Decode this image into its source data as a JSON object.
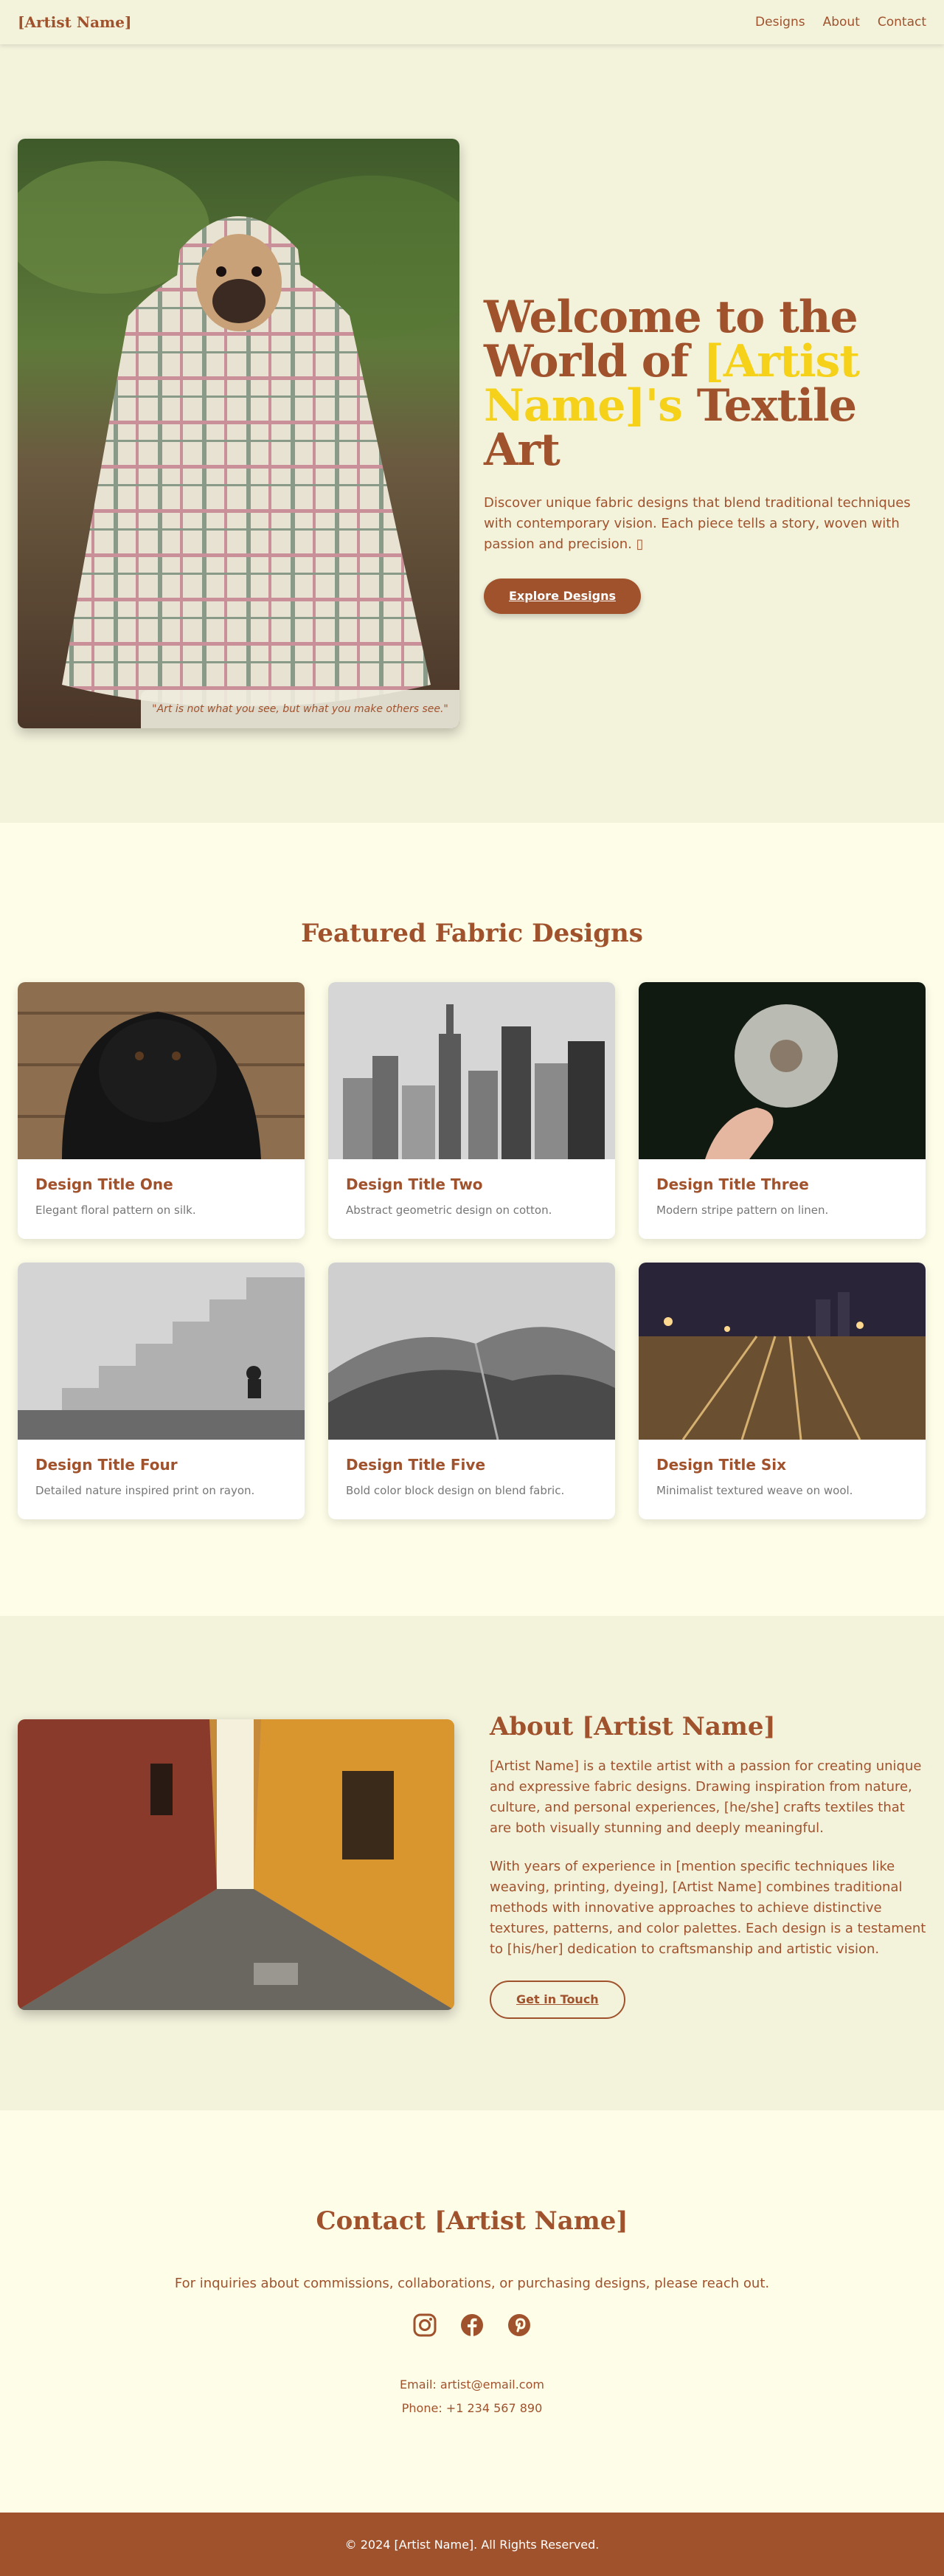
{
  "nav": {
    "brand": "[Artist Name]",
    "links": [
      "Designs",
      "About",
      "Contact"
    ]
  },
  "hero": {
    "title_part1": "Welcome to the World of ",
    "title_accent": "[Artist Name]'s",
    "title_part2": " Textile Art",
    "description": "Discover unique fabric designs that blend traditional techniques with contemporary vision. Each piece tells a story, woven with passion and precision. ▯",
    "button": "Explore Designs",
    "quote": "\"Art is not what you see, but what you make others see.\""
  },
  "featured": {
    "title": "Featured Fabric Designs",
    "cards": [
      {
        "title": "Design Title One",
        "desc": "Elegant floral pattern on silk."
      },
      {
        "title": "Design Title Two",
        "desc": "Abstract geometric design on cotton."
      },
      {
        "title": "Design Title Three",
        "desc": "Modern stripe pattern on linen."
      },
      {
        "title": "Design Title Four",
        "desc": "Detailed nature inspired print on rayon."
      },
      {
        "title": "Design Title Five",
        "desc": "Bold color block design on blend fabric."
      },
      {
        "title": "Design Title Six",
        "desc": "Minimalist textured weave on wool."
      }
    ]
  },
  "about": {
    "title": "About [Artist Name]",
    "p1": "[Artist Name] is a textile artist with a passion for creating unique and expressive fabric designs. Drawing inspiration from nature, culture, and personal experiences, [he/she] crafts textiles that are both visually stunning and deeply meaningful.",
    "p2": "With years of experience in [mention specific techniques like weaving, printing, dyeing], [Artist Name] combines traditional methods with innovative approaches to achieve distinctive textures, patterns, and color palettes. Each design is a testament to [his/her] dedication to craftsmanship and artistic vision.",
    "button": "Get in Touch"
  },
  "contact": {
    "title": "Contact [Artist Name]",
    "intro": "For inquiries about commissions, collaborations, or purchasing designs, please reach out.",
    "email": "Email: artist@email.com",
    "phone": "Phone: +1 234 567 890",
    "socials": [
      "instagram-icon",
      "facebook-icon",
      "pinterest-icon"
    ]
  },
  "footer": {
    "text": "© 2024 [Artist Name]. All Rights Reserved."
  },
  "colors": {
    "brand": "#a0522d",
    "accent": "#f5d11a",
    "bg_light": "#fdfde8",
    "bg_section": "#f3f3dc"
  }
}
